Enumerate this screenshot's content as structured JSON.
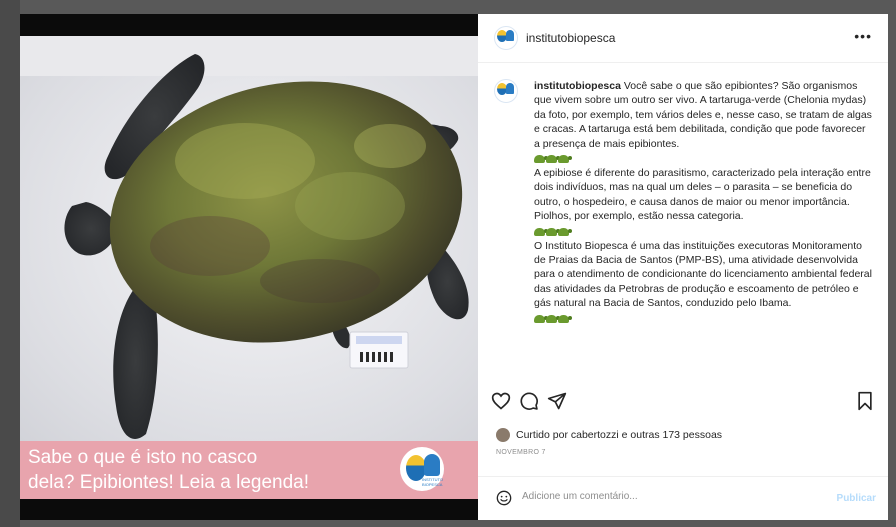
{
  "post": {
    "username": "institutobiopesca",
    "more_label": "•••",
    "caption_paragraphs": [
      "Você sabe o que são epibiontes? São organismos que vivem sobre um outro ser vivo. A tartaruga-verde (Chelonia mydas) da foto, por exemplo, tem vários deles e, nesse caso, se tratam de algas e cracas. A tartaruga está bem debilitada, condição que pode favorecer a presença de mais epibiontes.",
      "A epibiose é diferente do parasitismo, caracterizado pela interação entre dois indivíduos, mas na qual um deles – o parasita – se beneficia do outro, o hospedeiro, e causa danos de maior ou menor importância. Piolhos, por exemplo, estão nessa categoria.",
      "O Instituto Biopesca é uma das instituições executoras Monitoramento de Praias da Bacia de Santos (PMP-BS), uma atividade desenvolvida para o atendimento de condicionante do licenciamento ambiental federal das atividades da Petrobras de produção e escoamento de petróleo e gás natural na Bacia de Santos, conduzido pelo Ibama."
    ],
    "likes_text": "Curtido por cabertozzi e outras 173 pessoas",
    "date": "NOVEMBRO 7",
    "comment_placeholder": "Adicione um comentário...",
    "publish_label": "Publicar"
  },
  "image": {
    "banner_line1": "Sabe o que é isto no casco",
    "banner_line2": "dela? Epibiontes! Leia a legenda!",
    "logo_caption": "INSTITUTO BIOPESCA"
  },
  "icons": {
    "like": "heart-icon",
    "comment": "comment-icon",
    "share": "send-icon",
    "save": "bookmark-icon",
    "emoji": "smiley-icon",
    "turtle": "turtle-emoji-icon"
  },
  "colors": {
    "banner": "#e8a4ad",
    "publish_disabled": "#b6dcfb",
    "shell_algae": "#6f7d3a"
  }
}
